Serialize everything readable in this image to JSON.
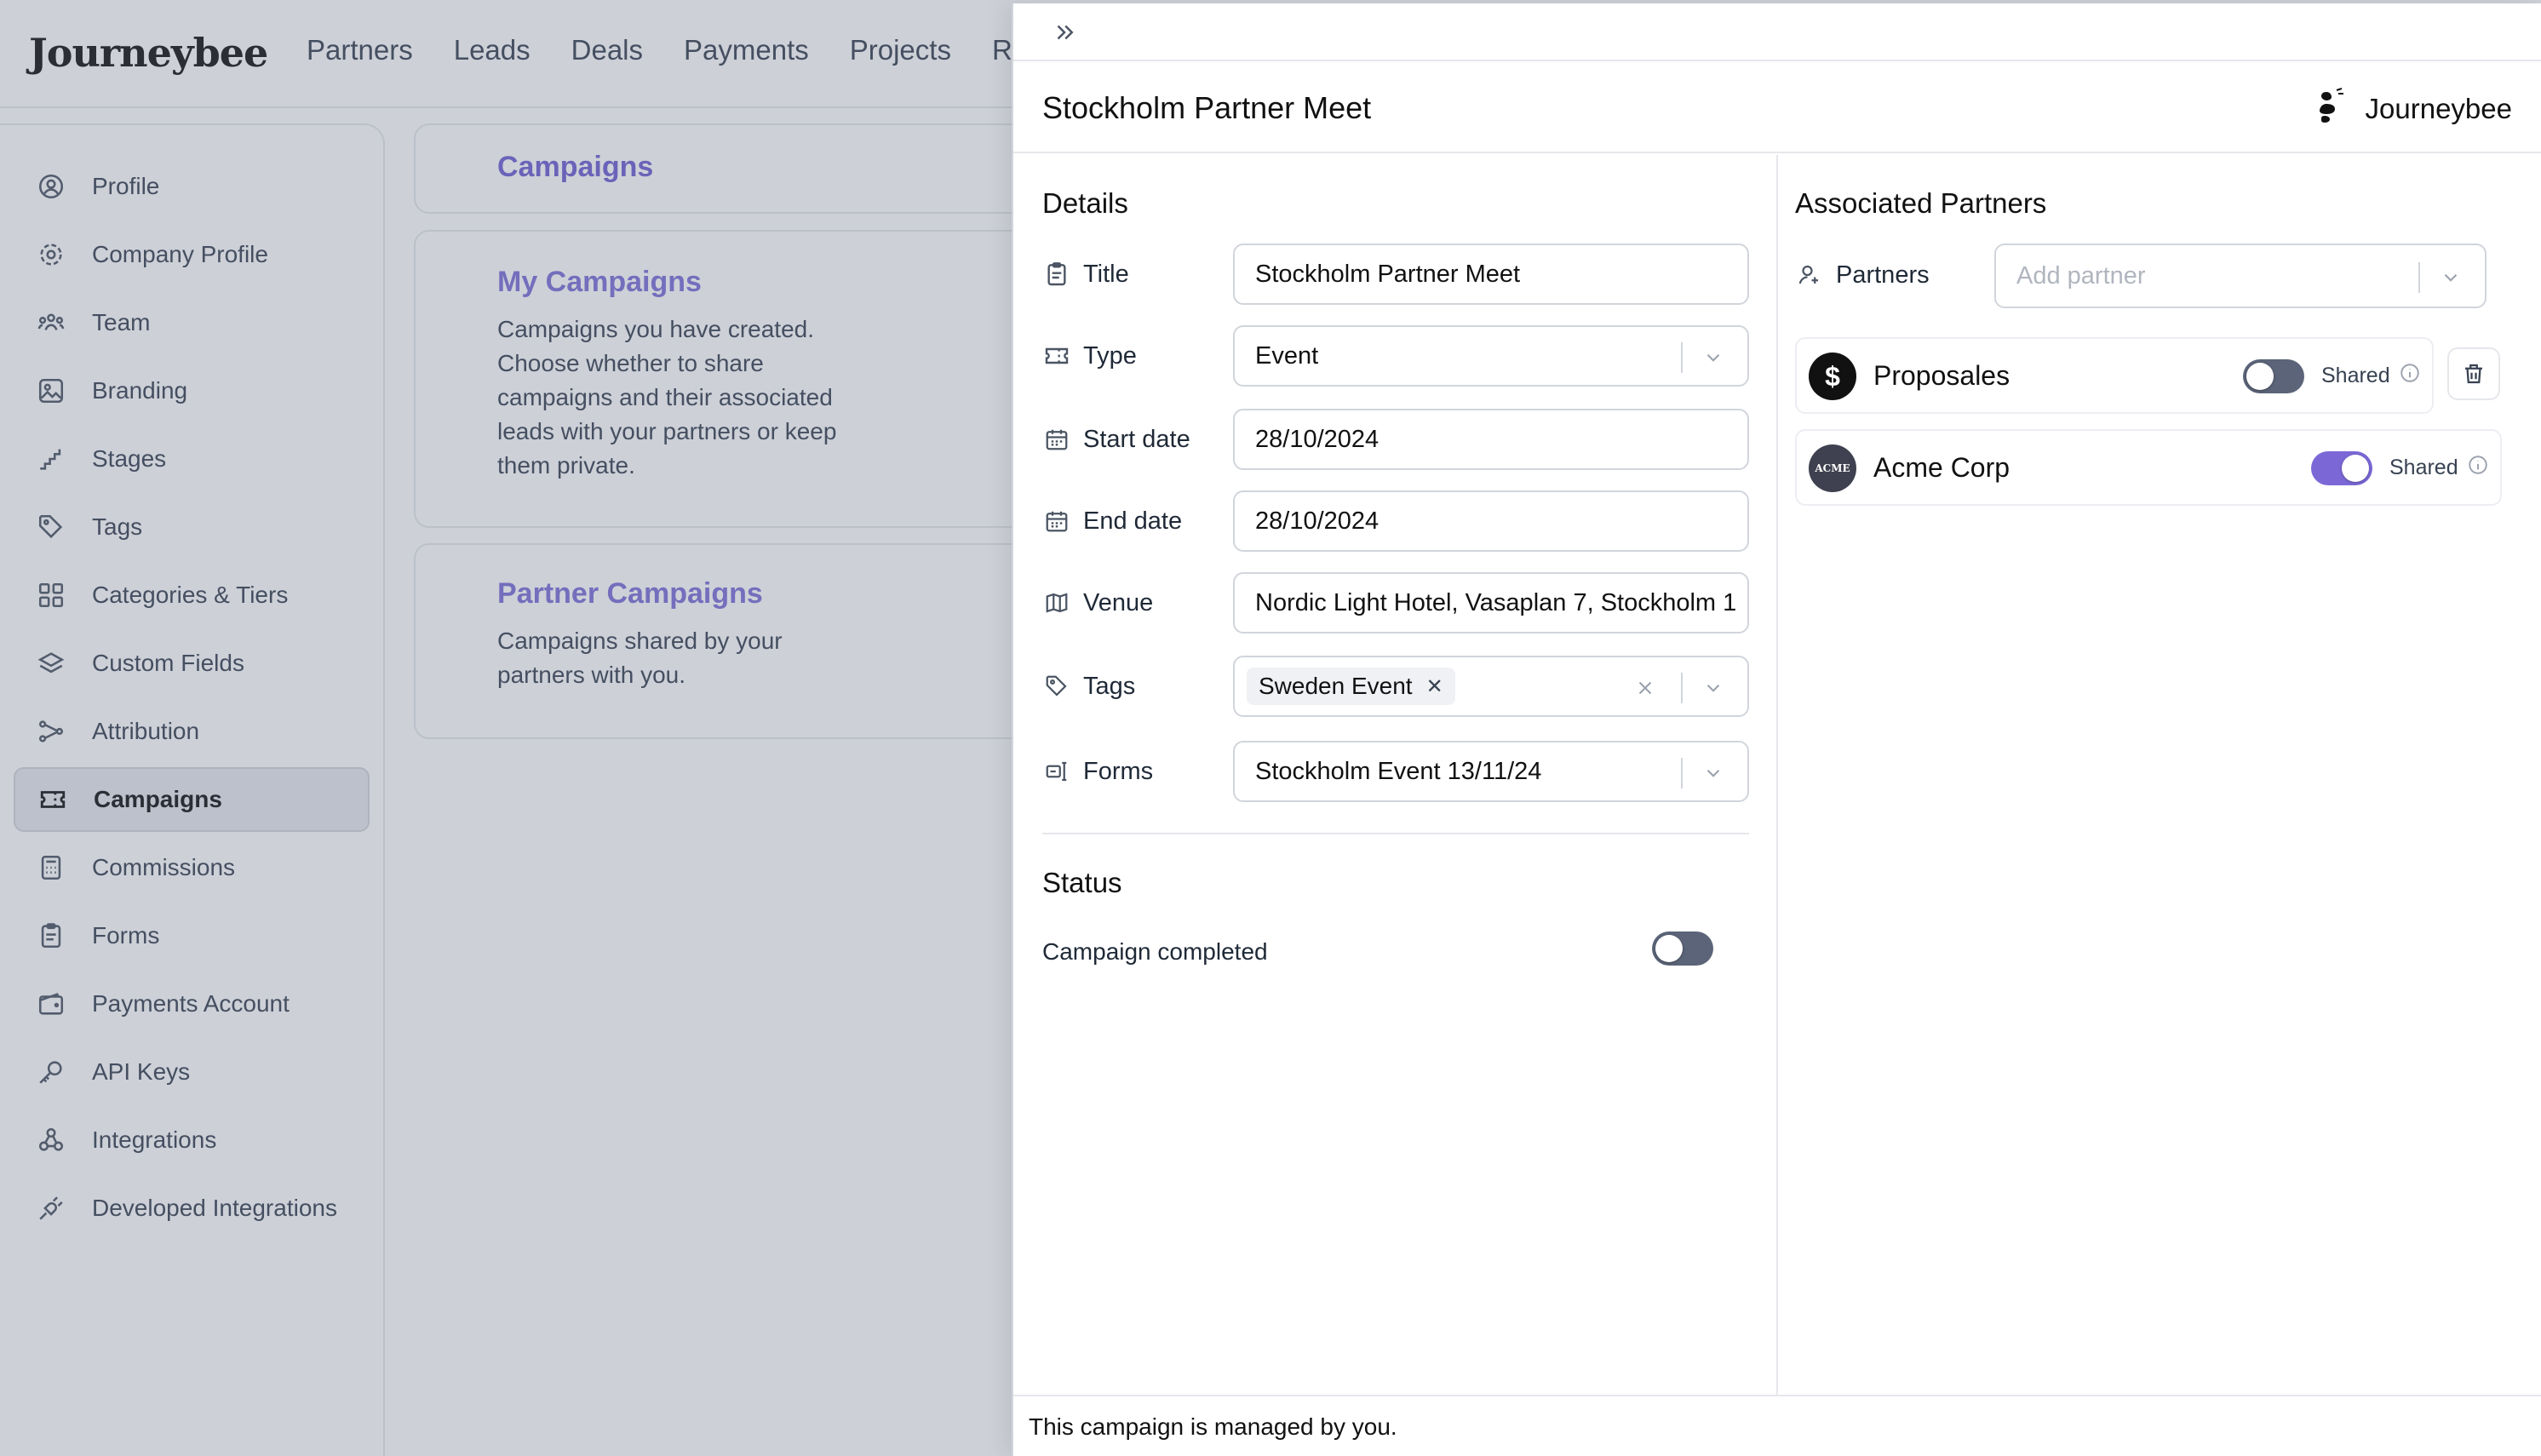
{
  "app": {
    "logo": "Journeybee",
    "nav": [
      "Partners",
      "Leads",
      "Deals",
      "Payments",
      "Projects",
      "R"
    ]
  },
  "sidebar": {
    "items": [
      {
        "label": "Profile",
        "icon": "user-circle-icon"
      },
      {
        "label": "Company Profile",
        "icon": "gear-icon"
      },
      {
        "label": "Team",
        "icon": "team-icon"
      },
      {
        "label": "Branding",
        "icon": "image-icon"
      },
      {
        "label": "Stages",
        "icon": "stages-icon"
      },
      {
        "label": "Tags",
        "icon": "tags-icon"
      },
      {
        "label": "Categories & Tiers",
        "icon": "grid-icon"
      },
      {
        "label": "Custom Fields",
        "icon": "layers-icon"
      },
      {
        "label": "Attribution",
        "icon": "share-icon"
      },
      {
        "label": "Campaigns",
        "icon": "ticket-icon",
        "active": true
      },
      {
        "label": "Commissions",
        "icon": "calculator-icon"
      },
      {
        "label": "Forms",
        "icon": "clipboard-icon"
      },
      {
        "label": "Payments Account",
        "icon": "wallet-icon"
      },
      {
        "label": "API Keys",
        "icon": "key-icon"
      },
      {
        "label": "Integrations",
        "icon": "webhook-icon"
      },
      {
        "label": "Developed Integrations",
        "icon": "plug-icon"
      }
    ]
  },
  "main": {
    "title": "Campaigns",
    "my_campaigns": {
      "title": "My Campaigns",
      "text": "Campaigns you have created. Choose whether to share campaigns and their associated leads with your partners or keep them private."
    },
    "partner_campaigns": {
      "title": "Partner Campaigns",
      "text": "Campaigns shared by your partners with you."
    }
  },
  "drawer": {
    "title": "Stockholm Partner Meet",
    "brand": "Journeybee",
    "details_title": "Details",
    "fields": {
      "title": {
        "label": "Title",
        "value": "Stockholm Partner Meet"
      },
      "type": {
        "label": "Type",
        "value": "Event"
      },
      "start_date": {
        "label": "Start date",
        "value": "28/10/2024"
      },
      "end_date": {
        "label": "End date",
        "value": "28/10/2024"
      },
      "venue": {
        "label": "Venue",
        "value": "Nordic Light Hotel, Vasaplan 7, Stockholm 1"
      },
      "tags": {
        "label": "Tags",
        "chips": [
          "Sweden Event"
        ]
      },
      "forms": {
        "label": "Forms",
        "value": "Stockholm Event 13/11/24"
      }
    },
    "status": {
      "title": "Status",
      "campaign_completed_label": "Campaign completed",
      "campaign_completed": false
    },
    "associated": {
      "title": "Associated Partners",
      "partners_label": "Partners",
      "placeholder": "Add partner",
      "list": [
        {
          "name": "Proposales",
          "shared_label": "Shared",
          "shared": false,
          "avatar_text": "$",
          "avatar_color": "#111111"
        },
        {
          "name": "Acme Corp",
          "shared_label": "Shared",
          "shared": true,
          "avatar_text": "ACME",
          "avatar_color": "#3f4150"
        }
      ]
    },
    "footer": "This campaign is managed by you."
  },
  "colors": {
    "accent": "#7b68d6",
    "link": "#6d5fd3",
    "toggle_off": "#5b6478"
  }
}
